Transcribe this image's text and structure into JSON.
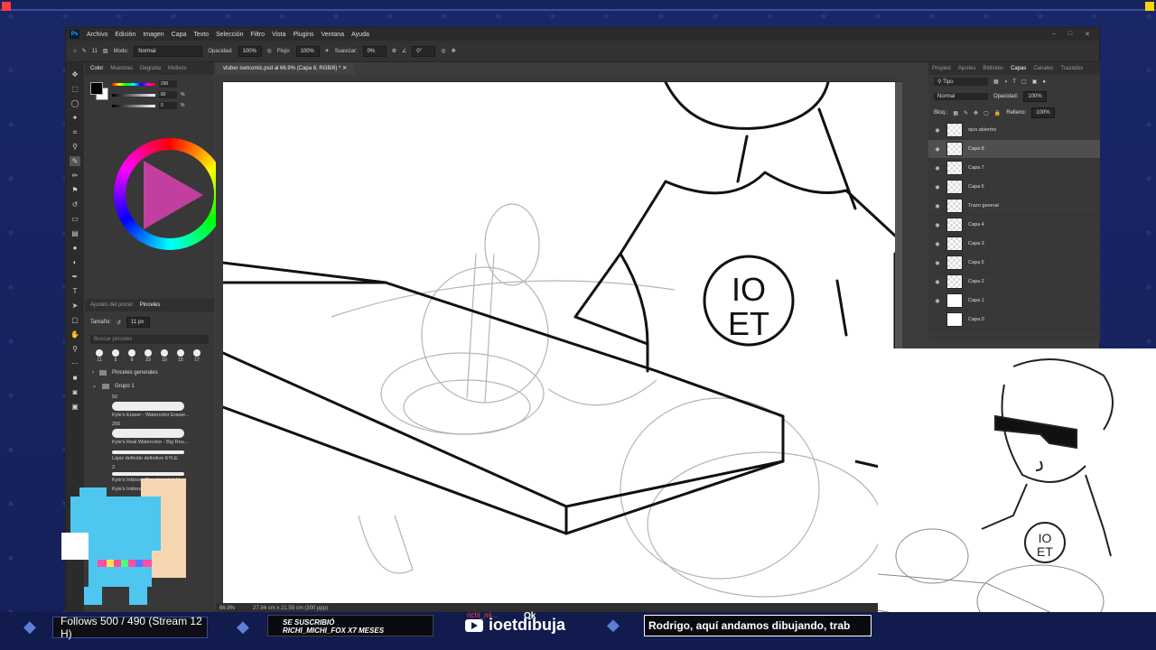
{
  "photoshop": {
    "logo": "Ps",
    "menu": [
      "Archivo",
      "Edición",
      "Imagen",
      "Capa",
      "Texto",
      "Selección",
      "Filtro",
      "Vista",
      "Plugins",
      "Ventana",
      "Ayuda"
    ],
    "options": {
      "modo_label": "Modo:",
      "modo_value": "Normal",
      "opacidad_label": "Opacidad:",
      "opacidad_value": "100%",
      "flujo_label": "Flujo:",
      "flujo_value": "100%",
      "suavizar_label": "Suavizar:",
      "suavizar_value": "0%",
      "angle_value": "0°",
      "brush_size": "11"
    },
    "document_tab": "vtuber ioetcomic.psd al 66.9% (Capa 8, RGB/8) *",
    "status": {
      "zoom": "66.9%",
      "doc_size": "27.94 cm x 21.59 cm (300 ppp)"
    },
    "color_panel": {
      "tabs": [
        "Color",
        "Muestras",
        "Degrada",
        "Motivos"
      ],
      "h_value": "290",
      "s_value": "80",
      "b_value": "0",
      "s_unit": "%",
      "b_unit": "%"
    },
    "brush_panel": {
      "tabs": [
        "Ajustes del pincel",
        "Pinceles"
      ],
      "size_label": "Tamaño:",
      "size_value": "11 px",
      "search_placeholder": "Buscar pinceles",
      "preset_sizes": [
        "11",
        "5",
        "9",
        "23",
        "10",
        "15",
        "17"
      ],
      "folders": [
        "Pinceles generales",
        "Grupo 1"
      ],
      "brushes": [
        {
          "size": "50",
          "name": "Kyle's Eraser - Watercolor Eraser..."
        },
        {
          "size": "250",
          "name": "Kyle's Real Watercolor - Big Rou..."
        },
        {
          "size": "",
          "name": "Lápiz definido definitivo KYLE"
        },
        {
          "size": "3",
          "name": "Kyle's Inkbox - Roughest Ink No..."
        },
        {
          "size": "",
          "name": "Kyle's Inkbox..."
        }
      ]
    },
    "layers_panel": {
      "tabs": [
        "Propied",
        "Ajustes",
        "Bibliotec",
        "Capas",
        "Canales",
        "Trazados"
      ],
      "filter": "Tipo",
      "blend_mode": "Normal",
      "opacity_label": "Opacidad:",
      "opacity_value": "100%",
      "lock_label": "Bloq.:",
      "fill_label": "Relleno:",
      "fill_value": "100%",
      "layers": [
        {
          "name": "ojos abiertos",
          "selected": false
        },
        {
          "name": "Capa 8",
          "selected": true
        },
        {
          "name": "Capa 7",
          "selected": false
        },
        {
          "name": "Capa 6",
          "selected": false
        },
        {
          "name": "Trazo general",
          "selected": false
        },
        {
          "name": "Capa 4",
          "selected": false
        },
        {
          "name": "Capa 3",
          "selected": false
        },
        {
          "name": "Capa 5",
          "selected": false
        },
        {
          "name": "Capa 2",
          "selected": false
        },
        {
          "name": "Capa 1",
          "selected": false
        },
        {
          "name": "Capa 0",
          "selected": false
        }
      ]
    }
  },
  "stream": {
    "follows": "Follows 500 / 490 (Stream 12 H)",
    "sub_alert_line1": "SE SUSCRIBIÓ",
    "sub_alert_line2": "RICHI_MICHI_FOX X7 MESES",
    "chat_user": "richi_mi...",
    "chat_msg": "Ok",
    "yt_handle": "ioetdibuja",
    "ticker": "Rodrigo, aquí andamos dibujando, trab"
  },
  "drawing": {
    "shirt_text_line1": "IO",
    "shirt_text_line2": "ET"
  },
  "colors": {
    "stream_bg": "#1c2a6a",
    "ps_bg": "#3c3c3c",
    "accent_red": "#ff2d2d",
    "accent_yellow": "#ffd400"
  }
}
